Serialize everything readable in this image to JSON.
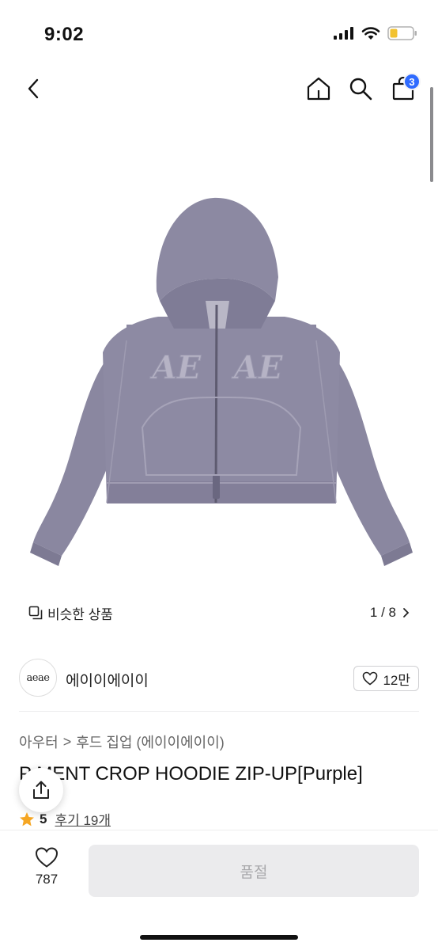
{
  "status_bar": {
    "time": "9:02"
  },
  "nav": {
    "cart_count": "3"
  },
  "gallery": {
    "similar_label": "비슷한 상품",
    "page_indicator": "1 / 8",
    "print_text": "AE AE"
  },
  "brand": {
    "logo_text": "aeae",
    "name": "에이이에이이",
    "like_count": "12만"
  },
  "breadcrumb": {
    "category": "아우터",
    "separator": ">",
    "subcategory": "후드 집업 (에이이에이이)"
  },
  "product": {
    "title": "P  MENT CROP HOODIE ZIP-UP[Purple]",
    "rating": "5",
    "review_label": "후기 19개"
  },
  "bottom_bar": {
    "wish_count": "787",
    "soldout_label": "품절"
  },
  "colors": {
    "accent": "#2f6bff",
    "hoodie": "#8a87a0",
    "star": "#f5a623"
  }
}
